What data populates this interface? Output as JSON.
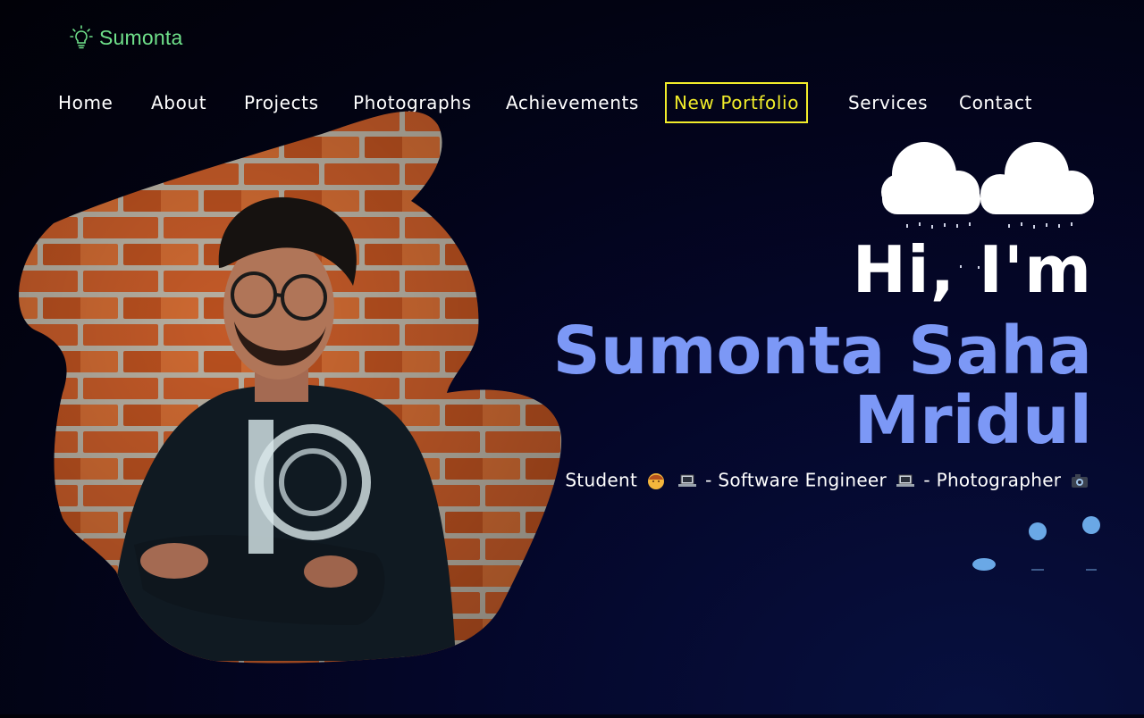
{
  "brand": {
    "name": "Sumonta",
    "icon": "lightbulb-icon",
    "color": "#6fe08a"
  },
  "nav": {
    "items": [
      {
        "label": "Home"
      },
      {
        "label": "About"
      },
      {
        "label": "Projects"
      },
      {
        "label": "Photographs"
      },
      {
        "label": "Achievements"
      },
      {
        "label": "New Portfolio",
        "highlighted": true
      },
      {
        "label": "Services"
      },
      {
        "label": "Contact"
      }
    ],
    "highlight_color": "#f1ec2a"
  },
  "hero": {
    "greeting": "Hi, I'm",
    "name_line1": "Sumonta Saha",
    "name_line2": "Mridul",
    "name_color": "#7c98f6",
    "tagline": {
      "role1": "Student",
      "sep1": " - ",
      "role2": "Software Engineer",
      "sep2": " - ",
      "role3": "Photographer"
    }
  },
  "decor": {
    "weather": "rain-clouds-icon",
    "drops": "water-drops-icon"
  }
}
